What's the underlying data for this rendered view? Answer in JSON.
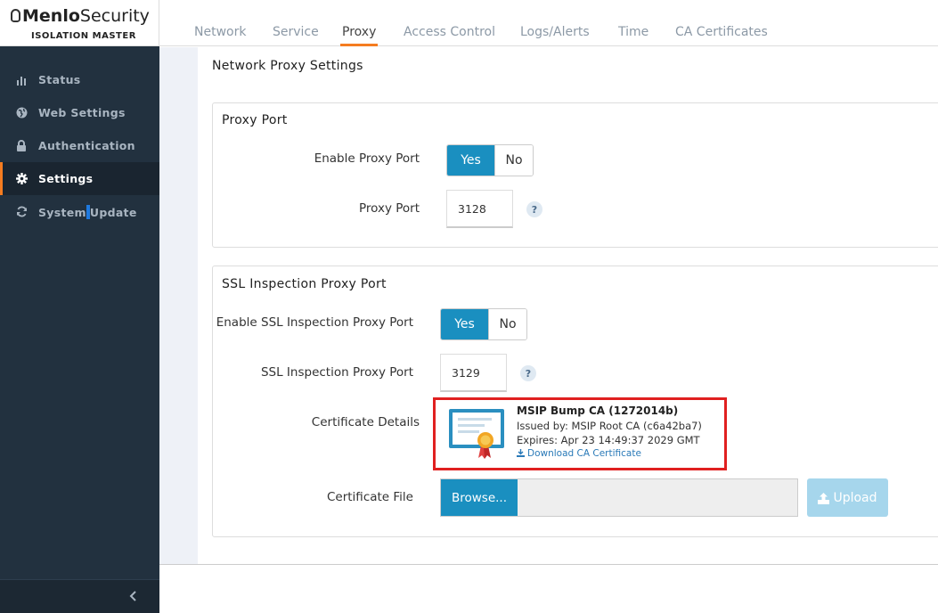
{
  "brand": {
    "name_bold": "Menlo",
    "name_regular": "Security",
    "subtitle": "ISOLATION MASTER"
  },
  "sidebar": {
    "items": [
      {
        "label": "Status",
        "icon": "bar-chart-icon",
        "active": false
      },
      {
        "label": "Web Settings",
        "icon": "globe-icon",
        "active": false
      },
      {
        "label": "Authentication",
        "icon": "lock-icon",
        "active": false
      },
      {
        "label": "Settings",
        "icon": "gear-icon",
        "active": true
      },
      {
        "label_a": "System",
        "label_b": "Update",
        "icon": "refresh-icon",
        "active": false
      }
    ],
    "collapse_icon": "chevron-left-icon"
  },
  "tabs": [
    {
      "label": "Network"
    },
    {
      "label": "Service"
    },
    {
      "label": "Proxy",
      "active": true
    },
    {
      "label": "Access Control"
    },
    {
      "label": "Logs/Alerts"
    },
    {
      "label": "Time"
    },
    {
      "label": "CA Certificates"
    }
  ],
  "page": {
    "title": "Network Proxy Settings"
  },
  "proxy_port": {
    "section_title": "Proxy Port",
    "enable_label": "Enable Proxy Port",
    "yes_label": "Yes",
    "no_label": "No",
    "selected": "Yes",
    "port_label": "Proxy Port",
    "port_value": "3128",
    "help": "?"
  },
  "ssl_proxy": {
    "section_title": "SSL Inspection Proxy Port",
    "enable_label": "Enable SSL Inspection Proxy Port",
    "yes_label": "Yes",
    "no_label": "No",
    "selected": "Yes",
    "port_label": "SSL Inspection Proxy Port",
    "port_value": "3129",
    "help": "?",
    "cert_details_label": "Certificate Details",
    "cert": {
      "name": "MSIP Bump CA (1272014b)",
      "issuer": "Issued by: MSIP Root CA (c6a42ba7)",
      "expires": "Expires: Apr 23 14:49:37 2029 GMT",
      "download_label": "Download CA Certificate"
    },
    "cert_file_label": "Certificate File",
    "browse_label": "Browse...",
    "upload_label": "Upload"
  },
  "colors": {
    "accent": "#f57c20",
    "primary": "#1a8fc0",
    "sidebar_bg": "#22313f",
    "highlight": "#e02020"
  }
}
